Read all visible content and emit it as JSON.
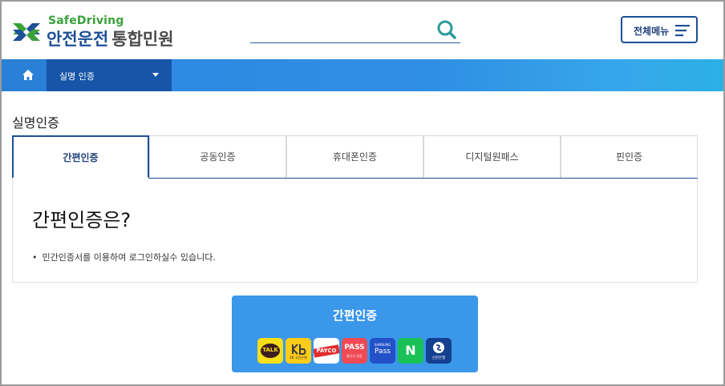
{
  "header": {
    "logo_en": "SafeDriving",
    "logo_ko": "안전운전",
    "logo_sub": "통합민원",
    "search_placeholder": "",
    "menu_label": "전체메뉴"
  },
  "nav": {
    "home_icon": "home-icon",
    "selected": "실명 인증"
  },
  "page": {
    "title": "실명인증"
  },
  "tabs": [
    {
      "label": "간편인증",
      "active": true
    },
    {
      "label": "공동인증",
      "active": false
    },
    {
      "label": "휴대폰인증",
      "active": false
    },
    {
      "label": "디지털원패스",
      "active": false
    },
    {
      "label": "핀인증",
      "active": false
    }
  ],
  "panel": {
    "heading": "간편인증은?",
    "bullet": "•",
    "description": "민간인증서를 이용하여 로그인하실수 있습니다."
  },
  "auth_button": {
    "label": "간편인증",
    "providers": [
      {
        "name": "kakao",
        "text": "TALK"
      },
      {
        "name": "kb",
        "text": "KB 국민은행"
      },
      {
        "name": "payco",
        "text": "PAYCO"
      },
      {
        "name": "pass",
        "text": "PASS",
        "sub": "통신사 인증"
      },
      {
        "name": "samsung-pass",
        "text": "Pass",
        "sub": "SAMSUNG"
      },
      {
        "name": "naver",
        "text": "N"
      },
      {
        "name": "shinhan",
        "text": "신한은행"
      }
    ]
  },
  "colors": {
    "brand_blue": "#1e4f97",
    "nav_blue": "#2e86e0",
    "button_blue": "#3a97ea",
    "logo_green": "#3aa03a"
  }
}
